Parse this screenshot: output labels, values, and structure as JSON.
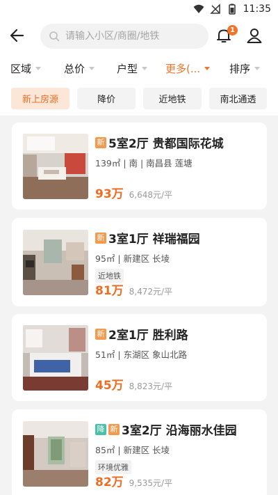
{
  "status_bar": {
    "time": "11:35"
  },
  "search": {
    "placeholder": "请输入小区/商圈/地铁"
  },
  "notification_count": "1",
  "filters": [
    {
      "label": "区域",
      "active": false
    },
    {
      "label": "总价",
      "active": false
    },
    {
      "label": "户型",
      "active": false
    },
    {
      "label": "更多(...",
      "active": true
    },
    {
      "label": "排序",
      "active": false
    }
  ],
  "chips": [
    {
      "label": "新上房源",
      "active": true
    },
    {
      "label": "降价",
      "active": false
    },
    {
      "label": "近地铁",
      "active": false
    },
    {
      "label": "南北通透",
      "active": false
    }
  ],
  "listings": [
    {
      "tags": [
        "新"
      ],
      "title": "5室2厅 贵都国际花城",
      "meta": "139㎡ | 南 | 南昌县 莲塘",
      "feature": "",
      "price": "93万",
      "unit_price": "6,648元/平"
    },
    {
      "tags": [
        "新"
      ],
      "title": "3室1厅 祥瑞福园",
      "meta": "95㎡ | 新建区 长堎",
      "feature": "近地铁",
      "price": "81万",
      "unit_price": "8,472元/平"
    },
    {
      "tags": [
        "新"
      ],
      "title": "2室1厅 胜利路",
      "meta": "51㎡ | 东湖区 象山北路",
      "feature": "",
      "price": "45万",
      "unit_price": "8,823元/平"
    },
    {
      "tags": [
        "降",
        "新"
      ],
      "title": "3室2厅 沿海丽水佳园",
      "meta": "85㎡ | 新建区 长堎",
      "feature": "环境优雅",
      "price": "82万",
      "unit_price": "9,535元/平"
    }
  ],
  "colors": {
    "accent": "#ee6d22",
    "new_tag": "#f49a4e",
    "drop_tag": "#49c0a8"
  }
}
